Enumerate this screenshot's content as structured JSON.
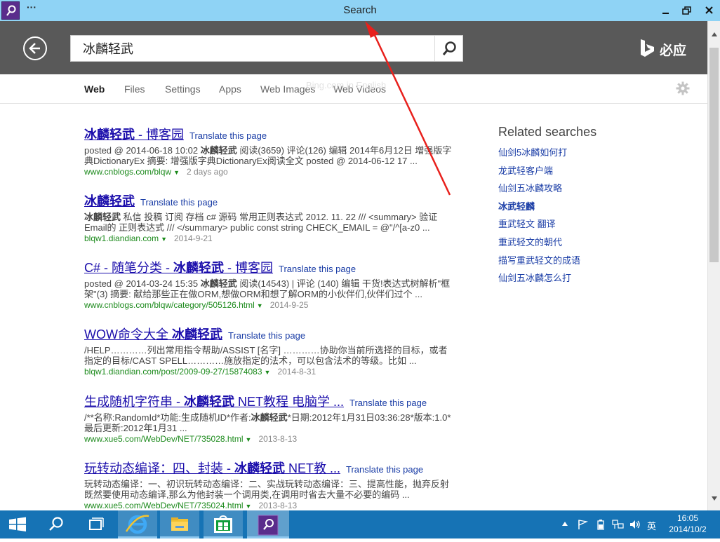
{
  "window": {
    "title": "Search",
    "menu_dots": "···"
  },
  "header": {
    "search_value": "冰麟轻武",
    "brand_text": "必应"
  },
  "nav": {
    "tabs": [
      "Web",
      "Files",
      "Settings",
      "Apps",
      "Web Images",
      "Web Videos"
    ],
    "active_tab": "Web",
    "overlay_text": "Bing.com in English"
  },
  "results": [
    {
      "title_pre": "",
      "title_bold": "冰麟轻武",
      "title_post": " - 博客园",
      "translate": "Translate this page",
      "snippet_1": "posted @ 2014-06-18 10:02 ",
      "snippet_bold": "冰麟轻武",
      "snippet_2": " 阅读(3659) 评论(126) 编辑 2014年6月12日 增强版字典DictionaryEx 摘要: 增强版字典DictionaryEx阅读全文 posted @ 2014-06-12 17 ...",
      "url": "www.cnblogs.com/blqw",
      "date": "2 days ago"
    },
    {
      "title_pre": "",
      "title_bold": "冰麟轻武",
      "title_post": "",
      "translate": "Translate this page",
      "snippet_1": "",
      "snippet_bold": "冰麟轻武",
      "snippet_2": " 私信 投稿 订阅 存档 c# 源码 常用正则表达式 2012. 11. 22 /// <summary> 验证Email的 正则表达式 /// </summary> public const string CHECK_EMAIL = @\"/^[a-z0 ...",
      "url": "blqw1.diandian.com",
      "date": "2014-9-21"
    },
    {
      "title_pre": "C# - 随笔分类 - ",
      "title_bold": "冰麟轻武",
      "title_post": " - 博客园",
      "translate": "Translate this page",
      "snippet_1": "posted @ 2014-03-24 15:35 ",
      "snippet_bold": "冰麟轻武",
      "snippet_2": " 阅读(14543) | 评论 (140) 编辑 干货!表达式树解析\"框架\"(3) 摘要: 献给那些正在做ORM,想做ORM和想了解ORM的小伙伴们,伙伴们过个 ...",
      "url": "www.cnblogs.com/blqw/category/505126.html",
      "date": "2014-9-25"
    },
    {
      "title_pre": "WOW命令大全 ",
      "title_bold": "冰麟轻武",
      "title_post": "",
      "translate": "Translate this page",
      "snippet_1": "/HELP…………列出常用指令帮助/ASSIST [名字] …………协助你当前所选择的目标，或者指定的目标/CAST SPELL…………施放指定的法术，可以包含法术的等级。比如 ...",
      "snippet_bold": "",
      "snippet_2": "",
      "url": "blqw1.diandian.com/post/2009-09-27/15874083",
      "date": "2014-8-31"
    },
    {
      "title_pre": "生成随机字符串 - ",
      "title_bold": "冰麟轻武",
      "title_post": " NET教程 电脑学 ...",
      "translate": "Translate this page",
      "snippet_1": "/**名称:RandomId*功能:生成随机ID*作者:",
      "snippet_bold": "冰麟轻武",
      "snippet_2": "*日期:2012年1月31日03:36:28*版本:1.0*最后更新:2012年1月31 ...",
      "url": "www.xue5.com/WebDev/NET/735028.html",
      "date": "2013-8-13"
    },
    {
      "title_pre": "玩转动态编译：四、封装 - ",
      "title_bold": "冰麟轻武",
      "title_post": " NET教 ...",
      "translate": "Translate this page",
      "snippet_1": "玩转动态编译：一、初识玩转动态编译：二、实战玩转动态编译：三、提高性能，抛弃反射 既然要使用动态编译,那么为他封装一个调用类,在调用时省去大量不必要的编码 ...",
      "snippet_bold": "",
      "snippet_2": "",
      "url": "www.xue5.com/WebDev/NET/735024.html",
      "date": "2013-8-13"
    }
  ],
  "related": {
    "title": "Related searches",
    "items": [
      {
        "label": "仙剑5冰麟如何打",
        "bold": false
      },
      {
        "label": "龙武轻客户端",
        "bold": false
      },
      {
        "label": "仙剑五冰麟攻略",
        "bold": false
      },
      {
        "label": "冰武轻麟",
        "bold": true
      },
      {
        "label": "重武轻文 翻译",
        "bold": false
      },
      {
        "label": "重武轻文的朝代",
        "bold": false
      },
      {
        "label": "描写重武轻文的成语",
        "bold": false
      },
      {
        "label": "仙剑五冰麟怎么打",
        "bold": false
      }
    ]
  },
  "taskbar": {
    "ime": "英",
    "time": "16:05",
    "date": "2014/10/2"
  },
  "colors": {
    "titlebar": "#8fd3f5",
    "header": "#595959",
    "taskbar": "#1673b5",
    "link": "#1a0dab",
    "url": "#1c8a1c",
    "annotation": "#e8201c"
  }
}
